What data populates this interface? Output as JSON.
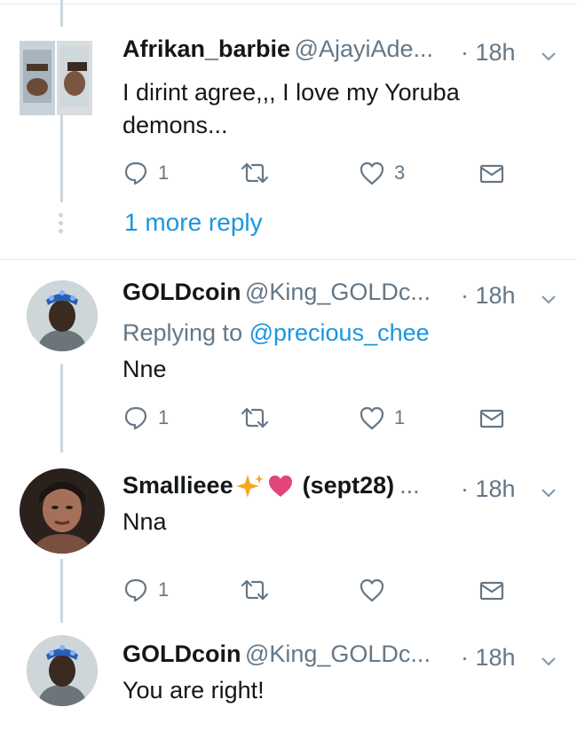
{
  "tweets": [
    {
      "name": "Afrikan_barbie",
      "handle": "@AjayiAde...",
      "sep": "·",
      "time": "18h",
      "text": "I dirint agree,,, I love my Yoruba demons...",
      "reply_count": "1",
      "like_count": "3",
      "more_replies": "1 more reply"
    },
    {
      "name": "GOLDcoin",
      "handle": "@King_GOLDc...",
      "sep": "·",
      "time": "18h",
      "replying_prefix": "Replying to",
      "replying_handle": "@precious_chee",
      "text": "Nne",
      "reply_count": "1",
      "like_count": "1"
    },
    {
      "name": "Smallieee",
      "handle": "(sept28)",
      "ellipsis": "...",
      "sep": "·",
      "time": "18h",
      "text": "Nna",
      "reply_count": "1",
      "like_count": ""
    },
    {
      "name": "GOLDcoin",
      "handle": "@King_GOLDc...",
      "sep": "·",
      "time": "18h",
      "text": "You are right!"
    }
  ],
  "icons": [
    "reply-icon",
    "retweet-icon",
    "like-icon",
    "dm-icon",
    "caret-down-icon"
  ],
  "colors": {
    "link": "#1b95e0",
    "muted": "#657786",
    "heart_emoji": "#e0457b",
    "sparkle_emoji": "#f5a623"
  }
}
